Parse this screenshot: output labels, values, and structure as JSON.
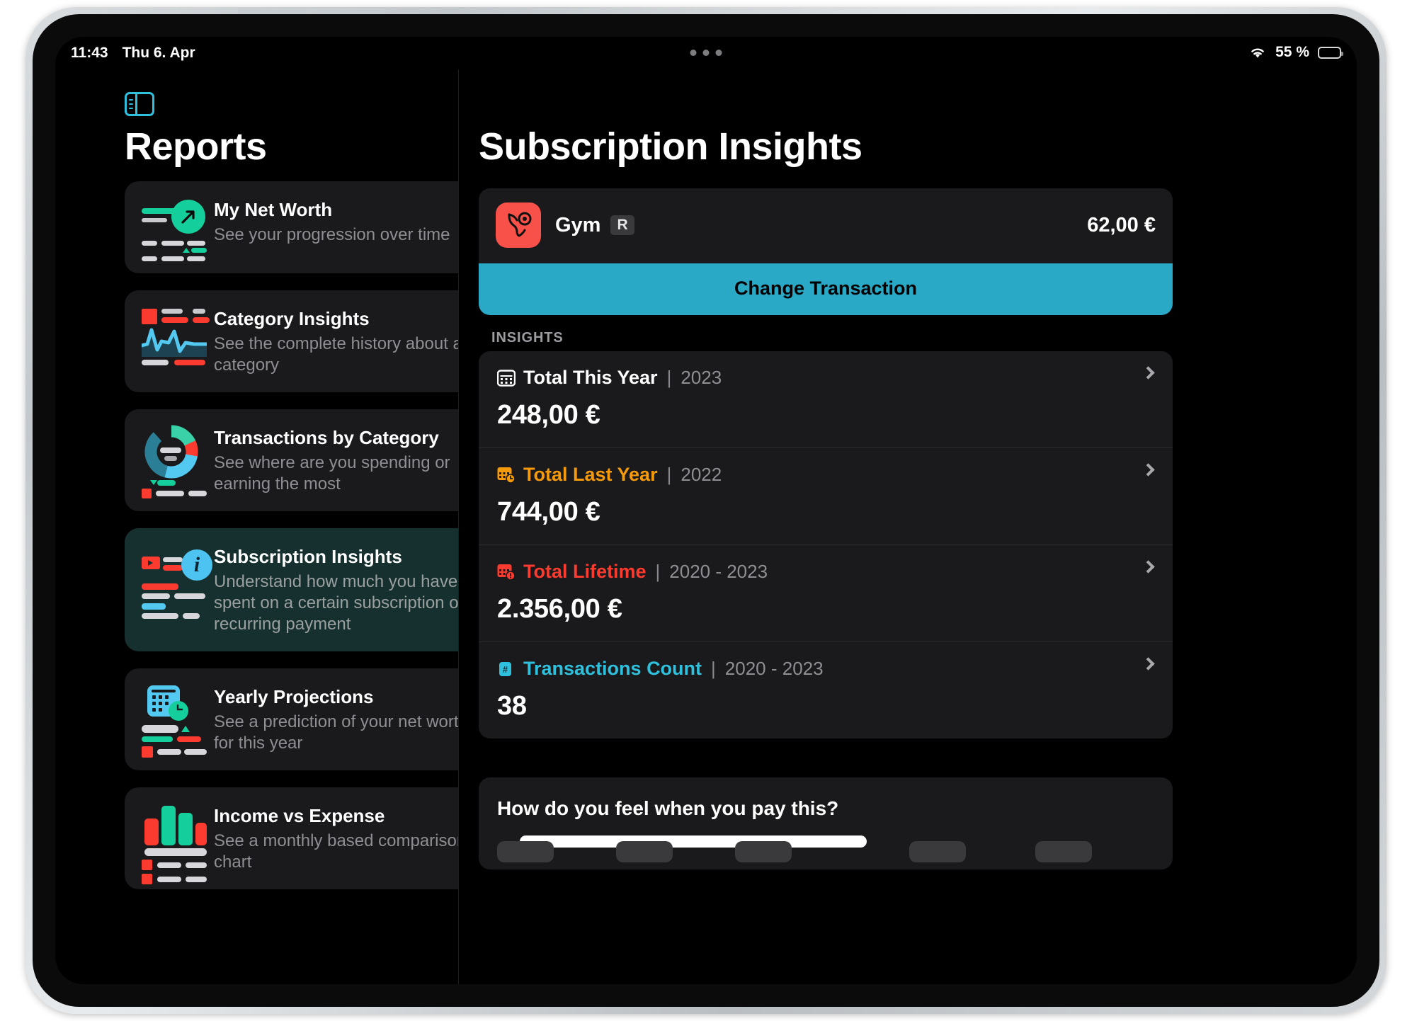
{
  "status_bar": {
    "time": "11:43",
    "date": "Thu 6. Apr",
    "battery_percent": "55 %",
    "wifi_icon": "wifi-icon",
    "battery_icon": "battery-icon",
    "multitask_icon": "multitasking-dots-icon"
  },
  "sidebar": {
    "toggle_icon": "sidebar-toggle-icon",
    "title": "Reports",
    "items": [
      {
        "title": "My Net Worth",
        "subtitle": "See your progression over time",
        "icon": "net-worth-arrow-icon",
        "selected": false
      },
      {
        "title": "Category Insights",
        "subtitle": "See the complete history about a category",
        "icon": "category-line-chart-icon",
        "selected": false
      },
      {
        "title": "Transactions by Category",
        "subtitle": "See where are you spending or earning the most",
        "icon": "donut-chart-icon",
        "selected": false
      },
      {
        "title": "Subscription Insights",
        "subtitle": "Understand how much you have spent on a certain subscription or recurring payment",
        "icon": "info-circle-icon",
        "selected": true
      },
      {
        "title": "Yearly Projections",
        "subtitle": "See a prediction of your net worth for this year",
        "icon": "calendar-clock-icon",
        "selected": false
      },
      {
        "title": "Income vs Expense",
        "subtitle": "See a monthly based comparison chart",
        "icon": "bar-chart-icon",
        "selected": false
      }
    ]
  },
  "detail": {
    "title": "Subscription Insights",
    "transaction": {
      "icon": "gym-muscle-icon",
      "name": "Gym",
      "badge": "R",
      "amount": "62,00 €",
      "change_button_label": "Change Transaction",
      "accent_color": "#2aa9c6",
      "icon_color": "#f8514a"
    },
    "insights_label": "INSIGHTS",
    "insights": [
      {
        "icon": "calendar-icon",
        "label": "Total This Year",
        "range": "2023",
        "value": "248,00 €",
        "color": "#ffffff",
        "chevron": "chevron-right-icon"
      },
      {
        "icon": "calendar-clock-icon",
        "label": "Total Last Year",
        "range": "2022",
        "value": "744,00 €",
        "color": "#f59b0b",
        "chevron": "chevron-right-icon"
      },
      {
        "icon": "calendar-alert-icon",
        "label": "Total Lifetime",
        "range": "2020 - 2023",
        "value": "2.356,00 €",
        "color": "#fb3b30",
        "chevron": "chevron-right-icon"
      },
      {
        "icon": "hash-icon",
        "label": "Transactions Count",
        "range": "2020 - 2023",
        "value": "38",
        "color": "#2ec0dc",
        "chevron": "chevron-right-icon"
      }
    ],
    "separator": "|",
    "feel_section": {
      "title": "How do you feel when you pay this?"
    }
  }
}
